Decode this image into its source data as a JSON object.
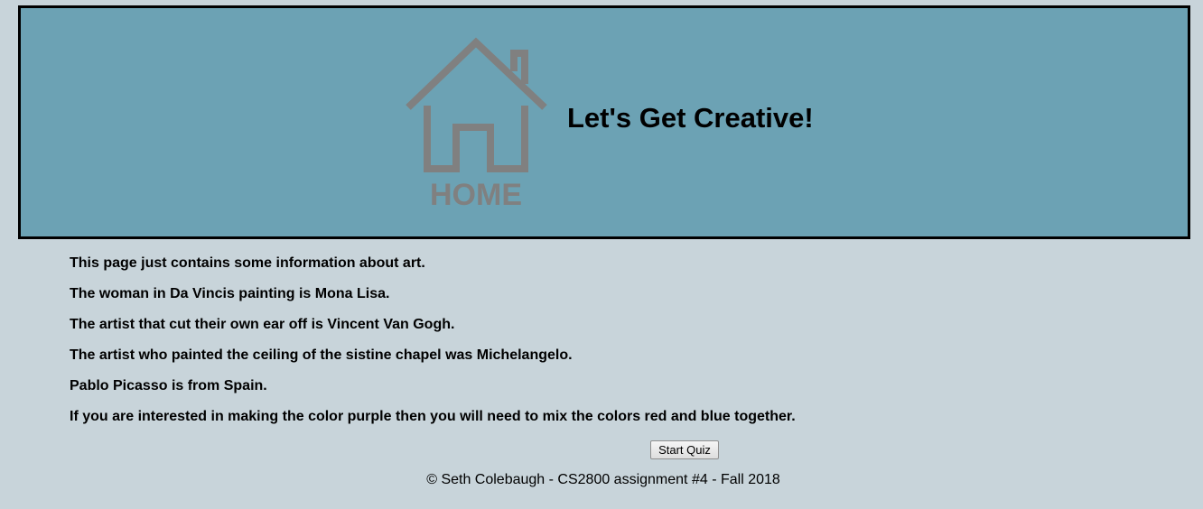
{
  "header": {
    "logo_text": "HOME",
    "title": "Let's Get Creative!",
    "logo_color": "#808080",
    "background_color": "#6ca2b4"
  },
  "main": {
    "facts": [
      "This page just contains some information about art.",
      "The woman in Da Vincis painting is Mona Lisa.",
      "The artist that cut their own ear off is Vincent Van Gogh.",
      "The artist who painted the ceiling of the sistine chapel was Michelangelo.",
      "Pablo Picasso is from Spain.",
      "If you are interested in making the color purple then you will need to mix the colors red and blue together."
    ],
    "quiz_button_label": "Start Quiz"
  },
  "footer": {
    "text": "© Seth Colebaugh - CS2800 assignment #4 - Fall 2018"
  },
  "page_background": "#c8d4da"
}
